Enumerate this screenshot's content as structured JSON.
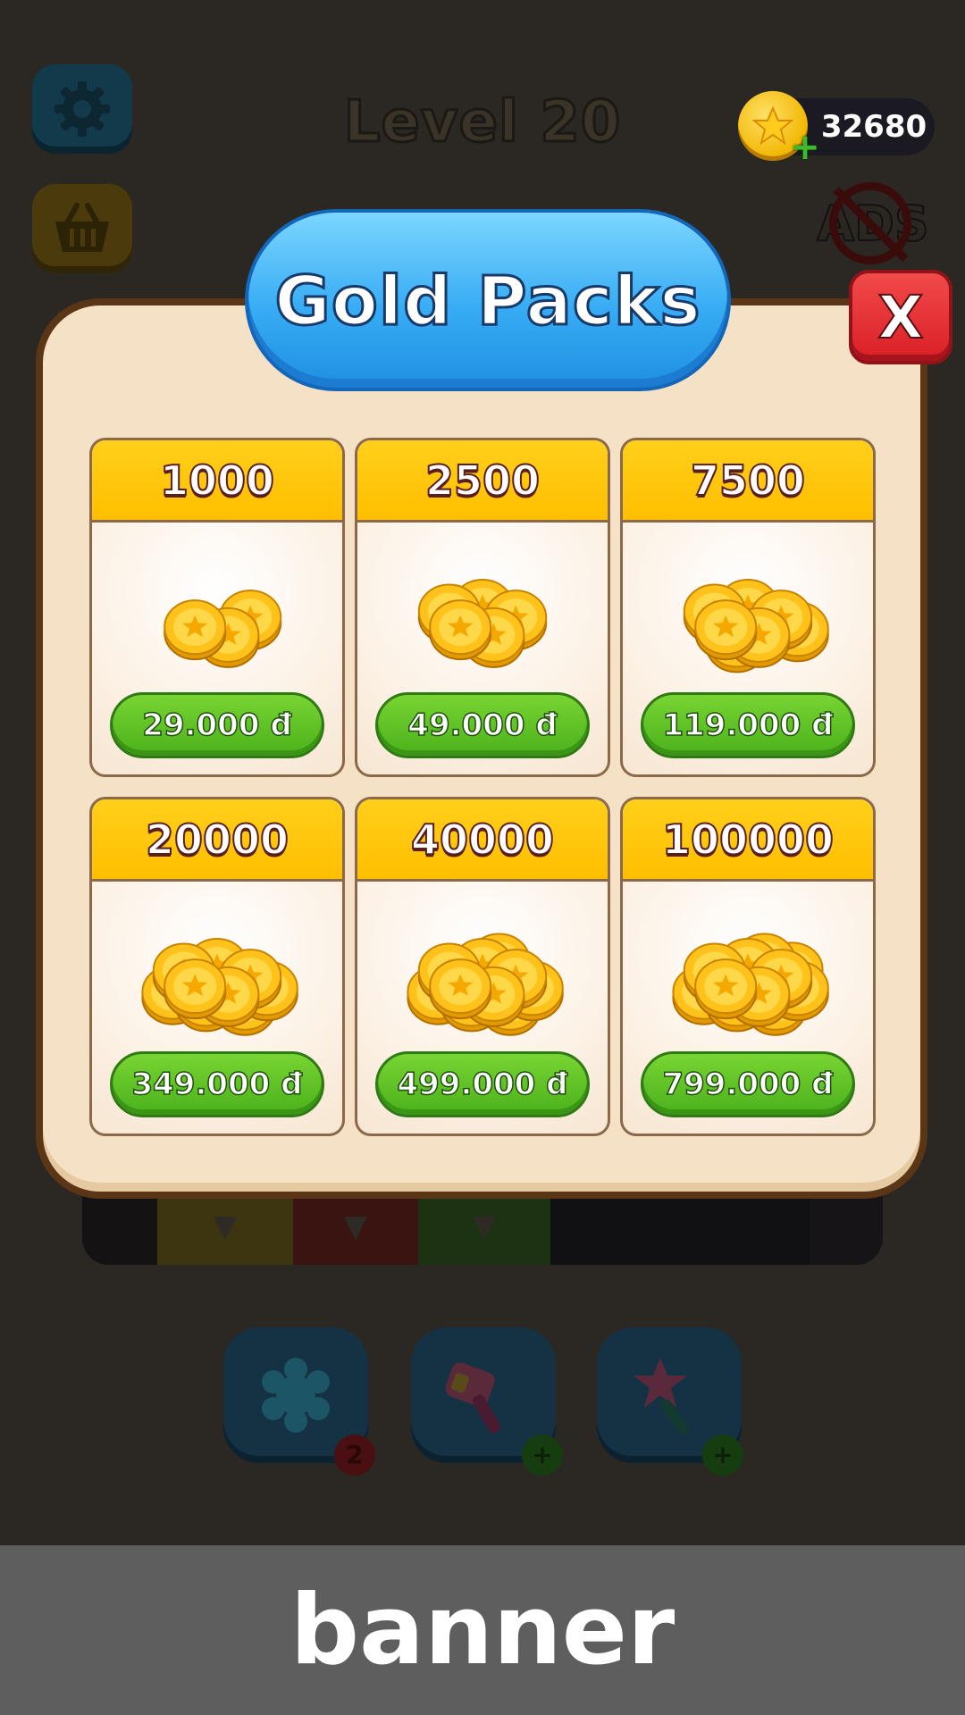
{
  "header": {
    "level_title": "Level 20",
    "coin_balance": "32680",
    "ads_label": "ADS"
  },
  "modal": {
    "title": "Gold Packs",
    "close_label": "X",
    "packs": [
      {
        "amount": "1000",
        "price": "29.000 đ",
        "coins": 3
      },
      {
        "amount": "2500",
        "price": "49.000 đ",
        "coins": 5
      },
      {
        "amount": "7500",
        "price": "119.000 đ",
        "coins": 7
      },
      {
        "amount": "20000",
        "price": "349.000 đ",
        "coins": 9
      },
      {
        "amount": "40000",
        "price": "499.000 đ",
        "coins": 11
      },
      {
        "amount": "100000",
        "price": "799.000 đ",
        "coins": 13
      }
    ]
  },
  "boosters": [
    {
      "icon": "snowflake-icon",
      "badge": "2"
    },
    {
      "icon": "hammer-icon",
      "badge": "+"
    },
    {
      "icon": "magic-wand-icon",
      "badge": "+"
    }
  ],
  "banner": {
    "label": "banner"
  },
  "colors": {
    "title_blue": "#37acf4",
    "price_green": "#4bb11c",
    "close_red": "#d91f26",
    "panel_cream": "#f5e1c5",
    "header_gold": "#ffbf00"
  }
}
